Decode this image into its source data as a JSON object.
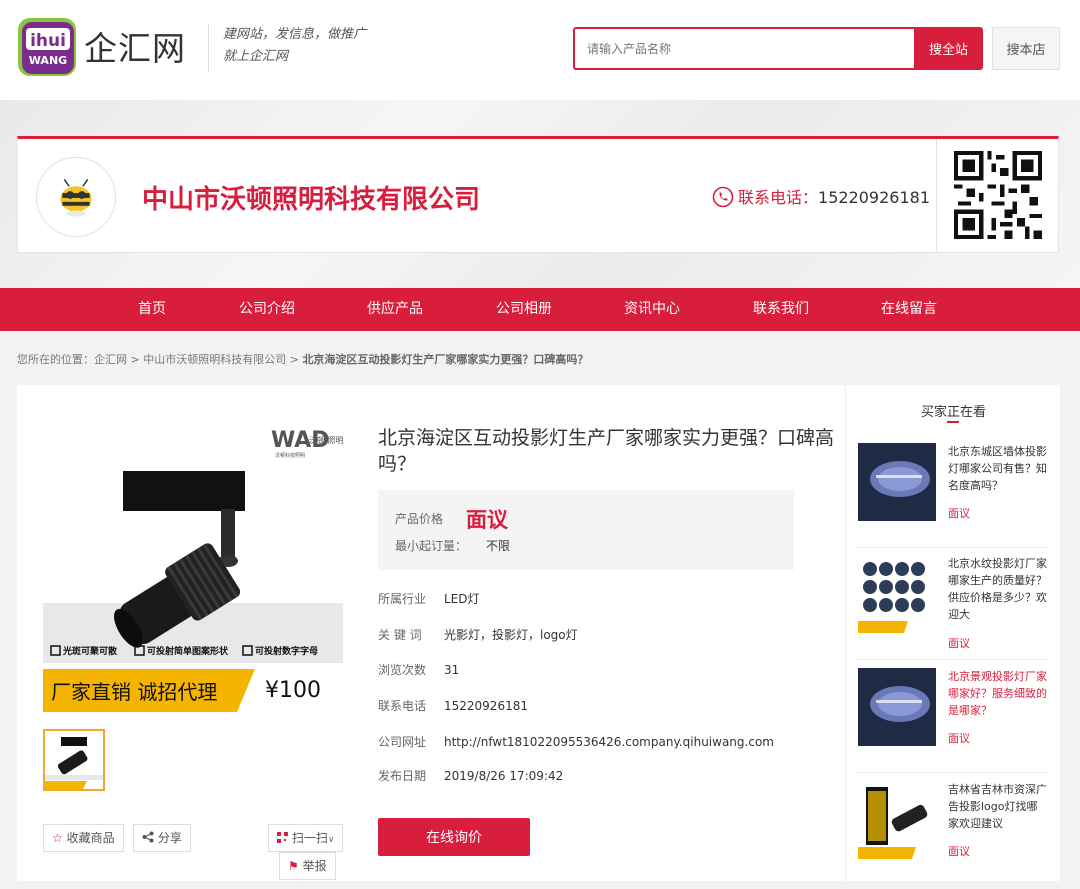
{
  "header": {
    "logo_text": "企汇网",
    "logo_badge_top": "ihui",
    "logo_badge_bottom": "WANG",
    "slogan_line1": "建网站，发信息，做推广",
    "slogan_line2": "就上企汇网",
    "search_placeholder": "请输入产品名称",
    "search_all_label": "搜全站",
    "search_store_label": "搜本店"
  },
  "company": {
    "name": "中山市沃顿照明科技有限公司",
    "phone_label": "联系电话：",
    "phone": "15220926181"
  },
  "nav": [
    "首页",
    "公司介绍",
    "供应产品",
    "公司相册",
    "资讯中心",
    "联系我们",
    "在线留言"
  ],
  "breadcrumb": {
    "prefix": "您所在的位置：",
    "site": "企汇网",
    "sep": " > ",
    "company": "中山市沃顿照明科技有限公司",
    "current": "北京海淀区互动投影灯生产厂家哪家实力更强？口碑高吗？"
  },
  "product": {
    "title": "北京海淀区互动投影灯生产厂家哪家实力更强？口碑高吗？",
    "price_label": "产品价格",
    "price": "面议",
    "moq_label": "最小起订量：",
    "moq": "不限",
    "fields": [
      {
        "k": "所属行业",
        "v": "LED灯"
      },
      {
        "k": "关 键 词",
        "v": "光影灯，投影灯，logo灯"
      },
      {
        "k": "浏览次数",
        "v": "31"
      },
      {
        "k": "联系电话",
        "v": "15220926181"
      },
      {
        "k": "公司网址",
        "v": "http://nfwt181022095536426.company.qihuiwang.com"
      },
      {
        "k": "发布日期",
        "v": "2019/8/26 17:09:42"
      }
    ],
    "inquiry_label": "在线询价",
    "collect_label": "收藏商品",
    "share_label": "分享",
    "scan_label": "扫一扫",
    "report_label": "举报",
    "image": {
      "brand_cn": "沃顿 照明",
      "brand_en": "WAD",
      "brand_sub": "沃顿科技照明",
      "features": [
        "光斑可聚可散",
        "可投射简单图案形状",
        "可投射数字字母"
      ],
      "banner": "厂家直销 诚招代理",
      "price": "¥100"
    }
  },
  "sidebar": {
    "title": "买家正在看",
    "items": [
      {
        "text": "北京东城区墙体投影灯哪家公司有售？知名度高吗？",
        "price": "面议",
        "highlight": false
      },
      {
        "text": "北京水纹投影灯厂家哪家生产的质量好？供应价格是多少？欢迎大",
        "price": "面议",
        "highlight": false
      },
      {
        "text": "北京景观投影灯厂家哪家好？服务细致的是哪家？",
        "price": "面议",
        "highlight": true
      },
      {
        "text": "吉林省吉林市资深广告投影logo灯找哪家欢迎建议",
        "price": "面议",
        "highlight": false
      }
    ]
  },
  "colors": {
    "accent": "#d81e3c"
  }
}
